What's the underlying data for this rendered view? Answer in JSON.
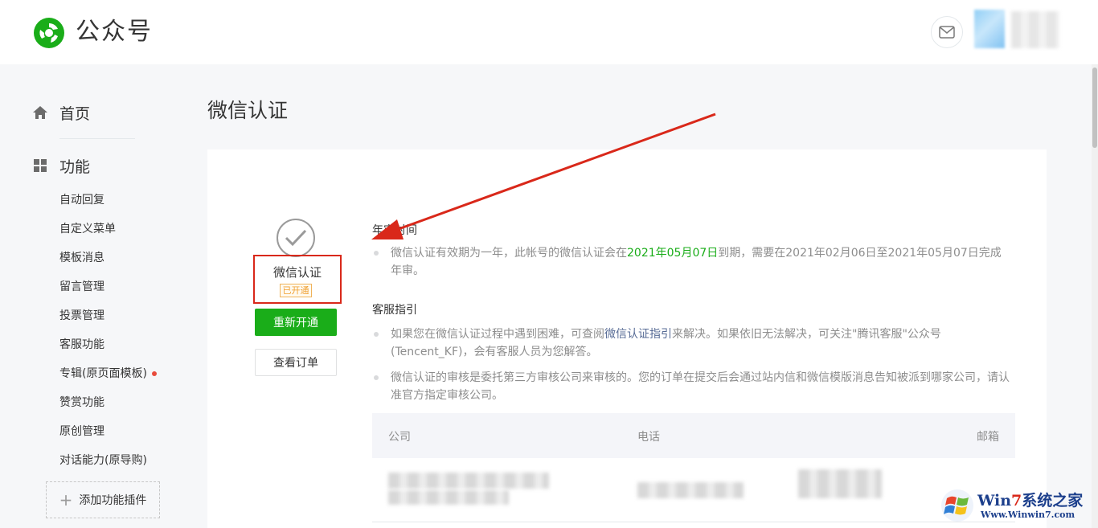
{
  "header": {
    "brand": "公众号",
    "icons": {
      "logo": "wechat-official-account-logo",
      "mail": "mail-icon"
    },
    "colors": {
      "brand_green": "#1aad19"
    }
  },
  "sidebar": {
    "home_label": "首页",
    "features_label": "功能",
    "items": [
      {
        "label": "自动回复"
      },
      {
        "label": "自定义菜单"
      },
      {
        "label": "模板消息"
      },
      {
        "label": "留言管理"
      },
      {
        "label": "投票管理"
      },
      {
        "label": "客服功能"
      },
      {
        "label": "专辑(原页面模板)",
        "has_dot": true
      },
      {
        "label": "赞赏功能"
      },
      {
        "label": "原创管理"
      },
      {
        "label": "对话能力(原导购)"
      }
    ],
    "add_plugin_label": "添加功能插件"
  },
  "main": {
    "page_title": "微信认证",
    "status": {
      "name": "微信认证",
      "badge": "已开通",
      "renew_button": "重新开通",
      "orders_button": "查看订单"
    },
    "annual_review": {
      "title": "年审时间",
      "text_before": "微信认证有效期为一年，此帐号的微信认证会在",
      "expiry_date": "2021年05月07日",
      "text_after": "到期，需要在2021年02月06日至2021年05月07日完成年审。"
    },
    "support": {
      "title": "客服指引",
      "p1_before": "如果您在微信认证过程中遇到困难，可查阅",
      "p1_link": "微信认证指引",
      "p1_after": "来解决。如果依旧无法解决，可关注\"腾讯客服\"公众号(Tencent_KF)，会有客服人员为您解答。",
      "p2": "微信认证的审核是委托第三方审核公司来审核的。您的订单在提交后会通过站内信和微信模版消息告知被派到哪家公司，请认准官方指定审核公司。"
    },
    "table": {
      "columns": [
        "公司",
        "电话",
        "邮箱"
      ]
    }
  },
  "watermark": {
    "title_a": "Win",
    "title_seven": "7",
    "title_b": "系统之家",
    "url": "Www.Winwin7.com"
  }
}
